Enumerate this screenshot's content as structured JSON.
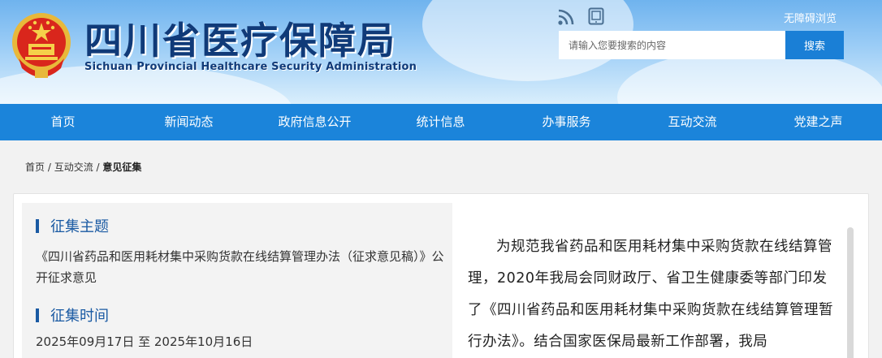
{
  "header": {
    "title_cn": "四川省医疗保障局",
    "title_en": "Sichuan Provincial Healthcare Security Administration",
    "accessibility_link": "无障碍浏览",
    "search": {
      "placeholder": "请输入您要搜索的内容",
      "button_label": "搜索"
    },
    "icons": [
      "rss-icon",
      "mobile-phone-icon",
      "national-emblem-logo"
    ]
  },
  "nav": {
    "items": [
      {
        "label": "首页"
      },
      {
        "label": "新闻动态"
      },
      {
        "label": "政府信息公开"
      },
      {
        "label": "统计信息"
      },
      {
        "label": "办事服务"
      },
      {
        "label": "互动交流"
      },
      {
        "label": "党建之声"
      }
    ]
  },
  "breadcrumb": {
    "home": "首页",
    "sep": " / ",
    "section": "互动交流",
    "current": "意见征集"
  },
  "consultation": {
    "topic_heading": "征集主题",
    "topic_text": "《四川省药品和医用耗材集中采购货款在线结算管理办法（征求意见稿）》公开征求意见",
    "time_heading": "征集时间",
    "time_text": "2025年09月17日 至 2025年10月16日",
    "body_text": "为规范我省药品和医用耗材集中采购货款在线结算管理，2020年我局会同财政厅、省卫生健康委等部门印发了《四川省药品和医用耗材集中采购货款在线结算管理暂行办法》。结合国家医保局最新工作部署，我局"
  },
  "colors": {
    "nav_bg": "#1b84da",
    "search_button": "#1a7fd6",
    "logo_text": "#103a78",
    "section_accent": "#1a5aa3"
  }
}
